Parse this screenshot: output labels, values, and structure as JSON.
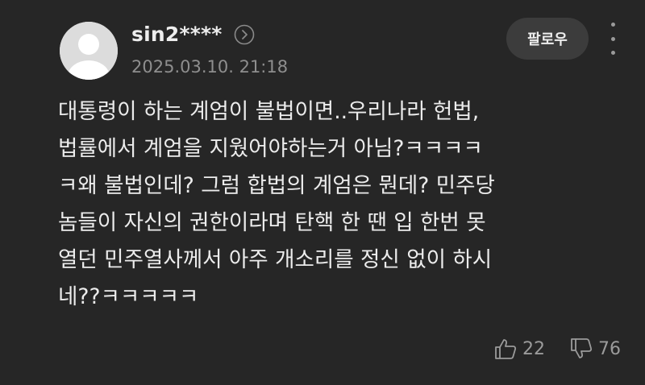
{
  "comment": {
    "author": "sin2****",
    "timestamp": "2025.03.10. 21:18",
    "follow_label": "팔로우",
    "body": "대통령이 하는 계엄이 불법이면..우리나라 헌법,\n법률에서 계엄을 지웠어야하는거 아님?ㅋㅋㅋㅋ\nㅋ왜 불법인데? 그럼 합법의 계엄은 뭔데? 민주당\n놈들이 자신의 권한이라며 탄핵 한 땐 입 한번 못\n열던 민주열사께서 아주 개소리를 정신 없이 하시\n네??ㅋㅋㅋㅋㅋ",
    "likes": "22",
    "dislikes": "76"
  },
  "icons": {
    "avatar": "default-user-avatar",
    "profile": "chevron-right-circle-icon",
    "more": "vertical-ellipsis-icon",
    "like": "thumbs-up-icon",
    "dislike": "thumbs-down-icon"
  }
}
